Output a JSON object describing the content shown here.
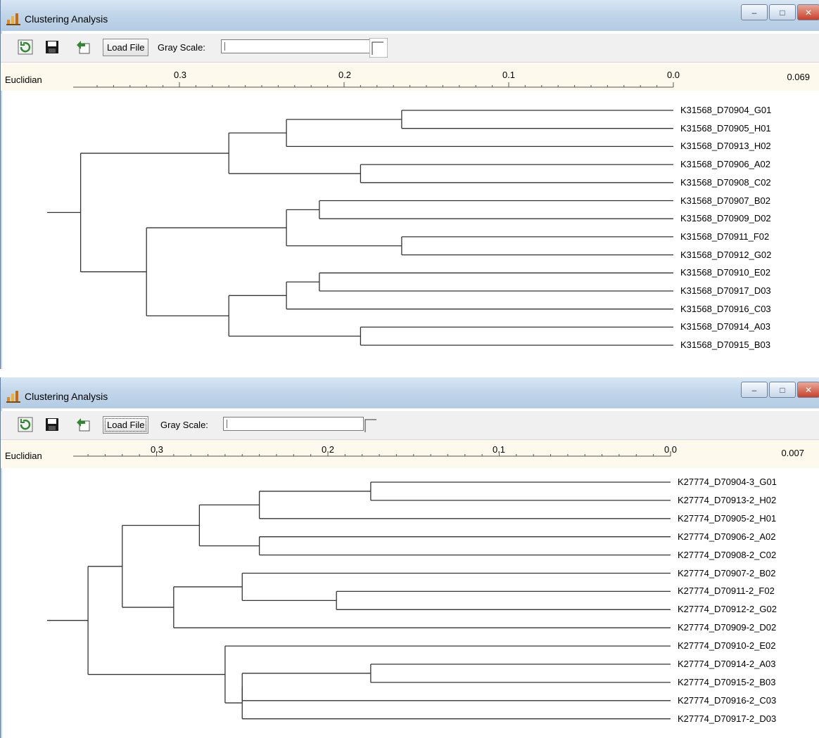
{
  "panels": [
    {
      "title": "Clustering Analysis",
      "toolbar": {
        "load_file": "Load File",
        "gray_scale": "Gray Scale:"
      },
      "metric": "Euclidian",
      "axis_ticks": [
        "0.3",
        "0.2",
        "0.1",
        "0.0"
      ],
      "value_label": "0.069",
      "leaves": [
        "K31568_D70904_G01",
        "K31568_D70905_H01",
        "K31568_D70913_H02",
        "K31568_D70906_A02",
        "K31568_D70908_C02",
        "K31568_D70907_B02",
        "K31568_D70909_D02",
        "K31568_D70911_F02",
        "K31568_D70912_G02",
        "K31568_D70910_E02",
        "K31568_D70917_D03",
        "K31568_D70916_C03",
        "K31568_D70914_A03",
        "K31568_D70915_B03"
      ]
    },
    {
      "title": "Clustering Analysis",
      "toolbar": {
        "load_file": "Load File",
        "gray_scale": "Gray Scale:"
      },
      "metric": "Euclidian",
      "axis_ticks": [
        "0.3",
        "0.2",
        "0.1",
        "0.0"
      ],
      "value_label": "0.007",
      "leaves": [
        "K27774_D70904-3_G01",
        "K27774_D70913-2_H02",
        "K27774_D70905-2_H01",
        "K27774_D70906-2_A02",
        "K27774_D70908-2_C02",
        "K27774_D70907-2_B02",
        "K27774_D70911-2_F02",
        "K27774_D70912-2_G02",
        "K27774_D70909-2_D02",
        "K27774_D70910-2_E02",
        "K27774_D70914-2_A03",
        "K27774_D70915-2_B03",
        "K27774_D70916-2_C03",
        "K27774_D70917-2_D03"
      ]
    }
  ],
  "chart_data": [
    {
      "type": "dendrogram",
      "axis_label": "Euclidian",
      "x_ticks": [
        0.3,
        0.2,
        0.1,
        0.0
      ],
      "xlim": [
        0.0,
        0.35
      ],
      "leaves": [
        "K31568_D70904_G01",
        "K31568_D70905_H01",
        "K31568_D70913_H02",
        "K31568_D70906_A02",
        "K31568_D70908_C02",
        "K31568_D70907_B02",
        "K31568_D70909_D02",
        "K31568_D70911_F02",
        "K31568_D70912_G02",
        "K31568_D70910_E02",
        "K31568_D70917_D03",
        "K31568_D70916_C03",
        "K31568_D70914_A03",
        "K31568_D70915_B03"
      ],
      "merges": [
        [
          0,
          1,
          0.165
        ],
        [
          14,
          2,
          0.235
        ],
        [
          3,
          4,
          0.19
        ],
        [
          15,
          16,
          0.27
        ],
        [
          5,
          6,
          0.215
        ],
        [
          7,
          8,
          0.165
        ],
        [
          18,
          19,
          0.235
        ],
        [
          9,
          10,
          0.215
        ],
        [
          21,
          11,
          0.235
        ],
        [
          12,
          13,
          0.19
        ],
        [
          22,
          23,
          0.27
        ],
        [
          20,
          24,
          0.32
        ],
        [
          17,
          25,
          0.36
        ]
      ]
    },
    {
      "type": "dendrogram",
      "axis_label": "Euclidian",
      "x_ticks": [
        0.3,
        0.2,
        0.1,
        0.0
      ],
      "xlim": [
        0.0,
        0.36
      ],
      "leaves": [
        "K27774_D70904-3_G01",
        "K27774_D70913-2_H02",
        "K27774_D70905-2_H01",
        "K27774_D70906-2_A02",
        "K27774_D70908-2_C02",
        "K27774_D70907-2_B02",
        "K27774_D70911-2_F02",
        "K27774_D70912-2_G02",
        "K27774_D70909-2_D02",
        "K27774_D70910-2_E02",
        "K27774_D70914-2_A03",
        "K27774_D70915-2_B03",
        "K27774_D70916-2_C03",
        "K27774_D70917-2_D03"
      ],
      "merges": [
        [
          0,
          1,
          0.175
        ],
        [
          14,
          2,
          0.24
        ],
        [
          3,
          4,
          0.24
        ],
        [
          15,
          16,
          0.275
        ],
        [
          6,
          7,
          0.195
        ],
        [
          5,
          18,
          0.25
        ],
        [
          19,
          8,
          0.29
        ],
        [
          17,
          20,
          0.32
        ],
        [
          10,
          11,
          0.175
        ],
        [
          22,
          12,
          0.25
        ],
        [
          23,
          13,
          0.25
        ],
        [
          9,
          24,
          0.26
        ],
        [
          21,
          25,
          0.34
        ]
      ]
    }
  ],
  "colors": {
    "title_bar": "#c2d6ea",
    "ruler_band": "#fdf9ec",
    "toolbar": "#f0f0f0",
    "lines": "#333333"
  }
}
